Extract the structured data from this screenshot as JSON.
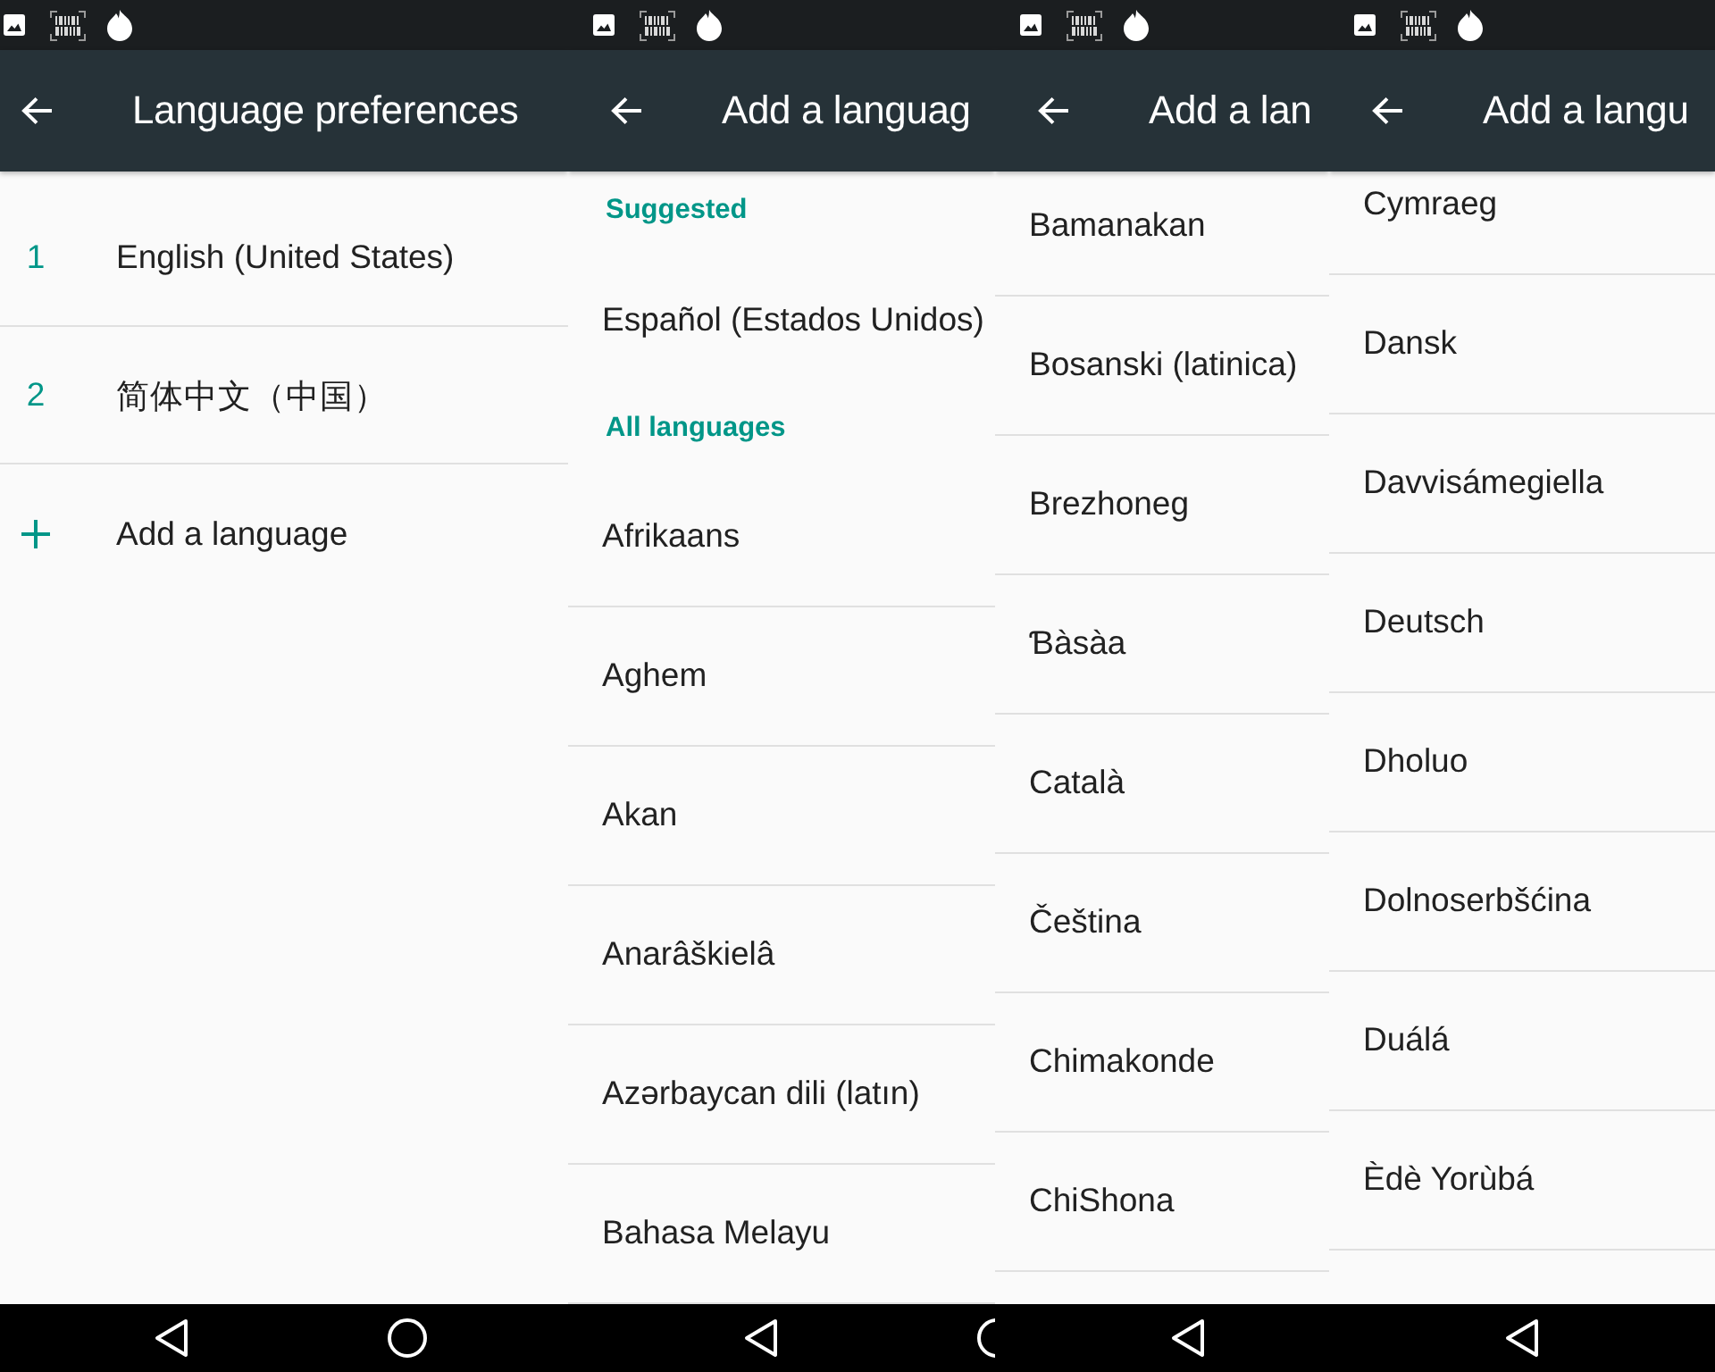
{
  "panels": [
    {
      "kind": "preferences",
      "app_bar": {
        "title": "Language preferences"
      },
      "languages": [
        {
          "number": "1",
          "name": "English (United States)"
        },
        {
          "number": "2",
          "name": "简体中文（中国）"
        }
      ],
      "add_button": {
        "label": "Add a language"
      },
      "nav_bar": [
        {
          "kind": "back"
        },
        {
          "kind": "home"
        }
      ]
    },
    {
      "kind": "picker",
      "app_bar": {
        "title": "Add a languag"
      },
      "sections": [
        {
          "header": "Suggested",
          "items": [
            "Español (Estados Unidos)"
          ]
        },
        {
          "header": "All languages",
          "items": [
            "Afrikaans",
            "Aghem",
            "Akan",
            "Anarâškielâ",
            "Azərbaycan dili (latın)",
            "Bahasa Melayu"
          ]
        }
      ],
      "nav_bar": [
        {
          "kind": "back"
        },
        {
          "kind": "home"
        }
      ]
    },
    {
      "kind": "picker",
      "app_bar": {
        "title": "Add a lan"
      },
      "sections": [
        {
          "items": [
            "Bamanakan",
            "Bosanski (latinica)",
            "Brezhoneg",
            "Ɓàsàa",
            "Català",
            "Čeština",
            "Chimakonde",
            "ChiShona"
          ]
        }
      ],
      "nav_bar": [
        {
          "kind": "back"
        }
      ]
    },
    {
      "kind": "picker",
      "app_bar": {
        "title": "Add a langu"
      },
      "sections": [
        {
          "items": [
            "Cymraeg",
            "Dansk",
            "Davvisámegiella",
            "Deutsch",
            "Dholuo",
            "Dolnoserbšćina",
            "Duálá",
            "Èdè Yorùbá"
          ]
        }
      ],
      "nav_bar": [
        {
          "kind": "back"
        }
      ]
    }
  ]
}
